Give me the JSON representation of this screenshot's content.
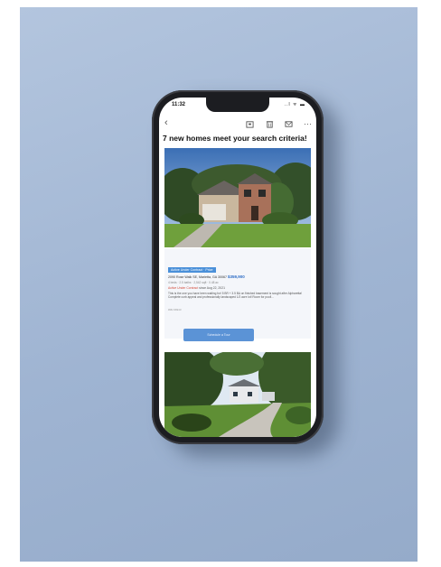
{
  "status_bar": {
    "time": "11:32",
    "indicators": "..l ᯤ ▬"
  },
  "toolbar": {
    "back_icon": "chevron-left-icon",
    "icons": [
      "archive-icon",
      "trash-icon",
      "mail-icon",
      "more-icon"
    ]
  },
  "email": {
    "subject": "7 new homes meet your search criteria!",
    "listing": {
      "badge": "Active Under Contract · Price",
      "address": "2090 Rose Walk SE, Marietta, GA 30067",
      "price": "$359,900",
      "specs": "4 beds · 2.5 baths · 2,542 sqft · 0.48 ac",
      "status": "Active Under Contract",
      "status_date": "since Aug 22, 2021",
      "description": "This is the one you have been waiting for! 5 BR + 3.5 BA on finished basement is sought after Alpharetta! Complete curb appeal and professionally landscaped 1/2 acre lot! Room for pool!...",
      "more": "#MLS6943"
    },
    "cta_label": "Schedule a Tour"
  },
  "colors": {
    "backdrop": "#a8bcd8",
    "accent": "#5b93d6",
    "status_red": "#d34b3b"
  }
}
